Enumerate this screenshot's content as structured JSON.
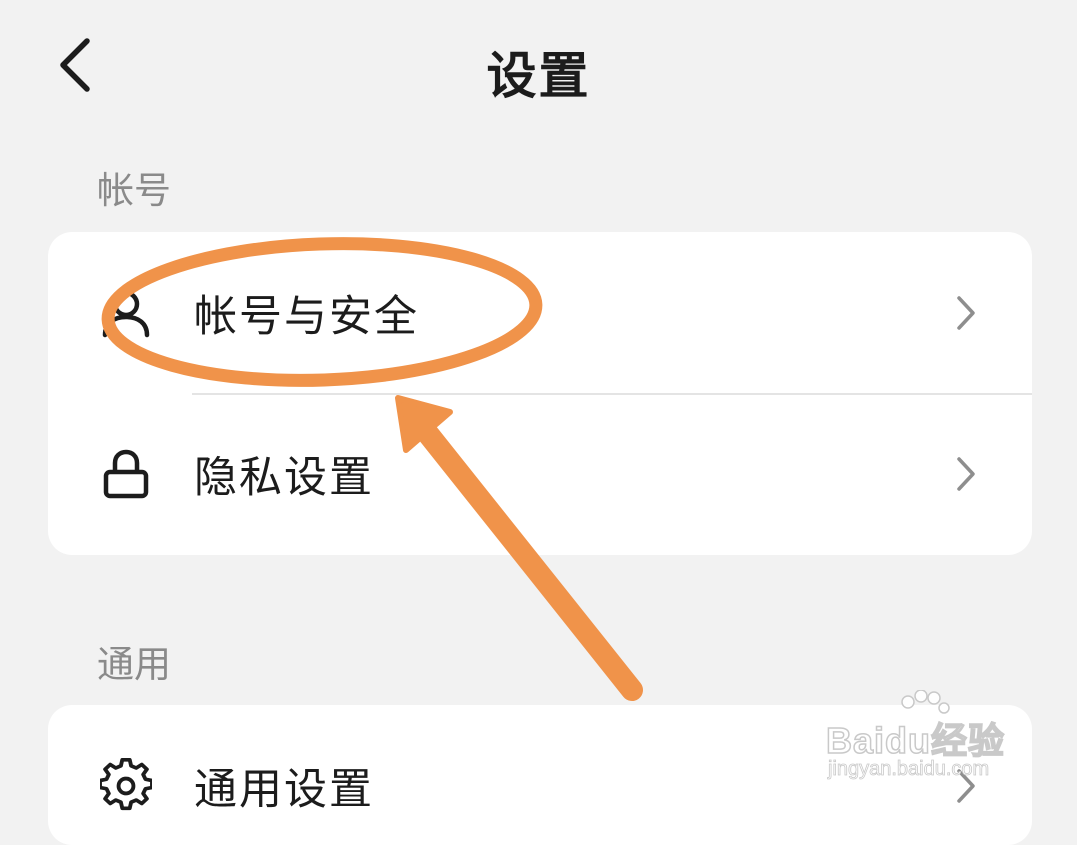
{
  "nav": {
    "title": "设置",
    "back_icon": "chevron-left-icon"
  },
  "sections": [
    {
      "header": "帐号",
      "rows": [
        {
          "label": "帐号与安全",
          "icon": "user-icon"
        },
        {
          "label": "隐私设置",
          "icon": "lock-icon"
        }
      ]
    },
    {
      "header": "通用",
      "rows": [
        {
          "label": "通用设置",
          "icon": "gear-icon"
        }
      ]
    }
  ],
  "annotation": {
    "color": "#f0934a",
    "highlight": "oval-around-account-security",
    "pointer": "arrow-to-account-security"
  },
  "watermark": {
    "main": "Baidu经验",
    "sub": "jingyan.baidu.com"
  },
  "colors": {
    "background": "#f2f2f2",
    "card": "#ffffff",
    "annotation": "#f0934a"
  }
}
